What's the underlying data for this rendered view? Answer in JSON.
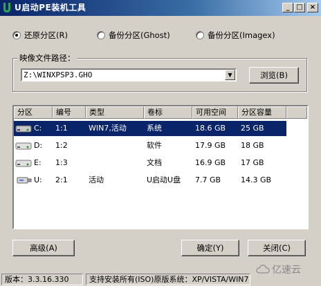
{
  "window": {
    "title": "U启动PE装机工具"
  },
  "titlebar_buttons": {
    "minimize": "_",
    "maximize": "□",
    "close": "×"
  },
  "modes": [
    {
      "label": "还原分区(R)",
      "checked": true
    },
    {
      "label": "备份分区(Ghost)",
      "checked": false
    },
    {
      "label": "备份分区(Imagex)",
      "checked": false
    }
  ],
  "image_group": {
    "label": "映像文件路径：",
    "path_value": "Z:\\WINXPSP3.GHO",
    "browse_label": "浏览(B)"
  },
  "partition_table": {
    "columns": [
      "分区",
      "编号",
      "类型",
      "卷标",
      "可用空间",
      "分区容量"
    ],
    "rows": [
      {
        "drive": "C:",
        "number": "1:1",
        "type": "WIN7,活动",
        "label": "系统",
        "free": "18.6 GB",
        "capacity": "25 GB",
        "selected": true,
        "icon": "hard-drive-icon"
      },
      {
        "drive": "D:",
        "number": "1:2",
        "type": "",
        "label": "软件",
        "free": "17.9 GB",
        "capacity": "18 GB",
        "selected": false,
        "icon": "hard-drive-icon"
      },
      {
        "drive": "E:",
        "number": "1:3",
        "type": "",
        "label": "文档",
        "free": "16.9 GB",
        "capacity": "17 GB",
        "selected": false,
        "icon": "hard-drive-icon"
      },
      {
        "drive": "U:",
        "number": "2:1",
        "type": "活动",
        "label": "U启动U盘",
        "free": "7.7 GB",
        "capacity": "14.3 GB",
        "selected": false,
        "icon": "usb-drive-icon"
      }
    ]
  },
  "buttons": {
    "advanced": "高级(A)",
    "ok": "确定(Y)",
    "close": "关闭(C)"
  },
  "statusbar": {
    "version": "版本：3.3.16.330",
    "support": "支持安装所有(ISO)原版系统：XP/VISTA/WIN7"
  },
  "watermark": {
    "text": "亿速云"
  },
  "colors": {
    "title_start": "#0a246a",
    "title_end": "#a6caf0",
    "selection": "#0a246a",
    "face": "#d4d0c8"
  }
}
